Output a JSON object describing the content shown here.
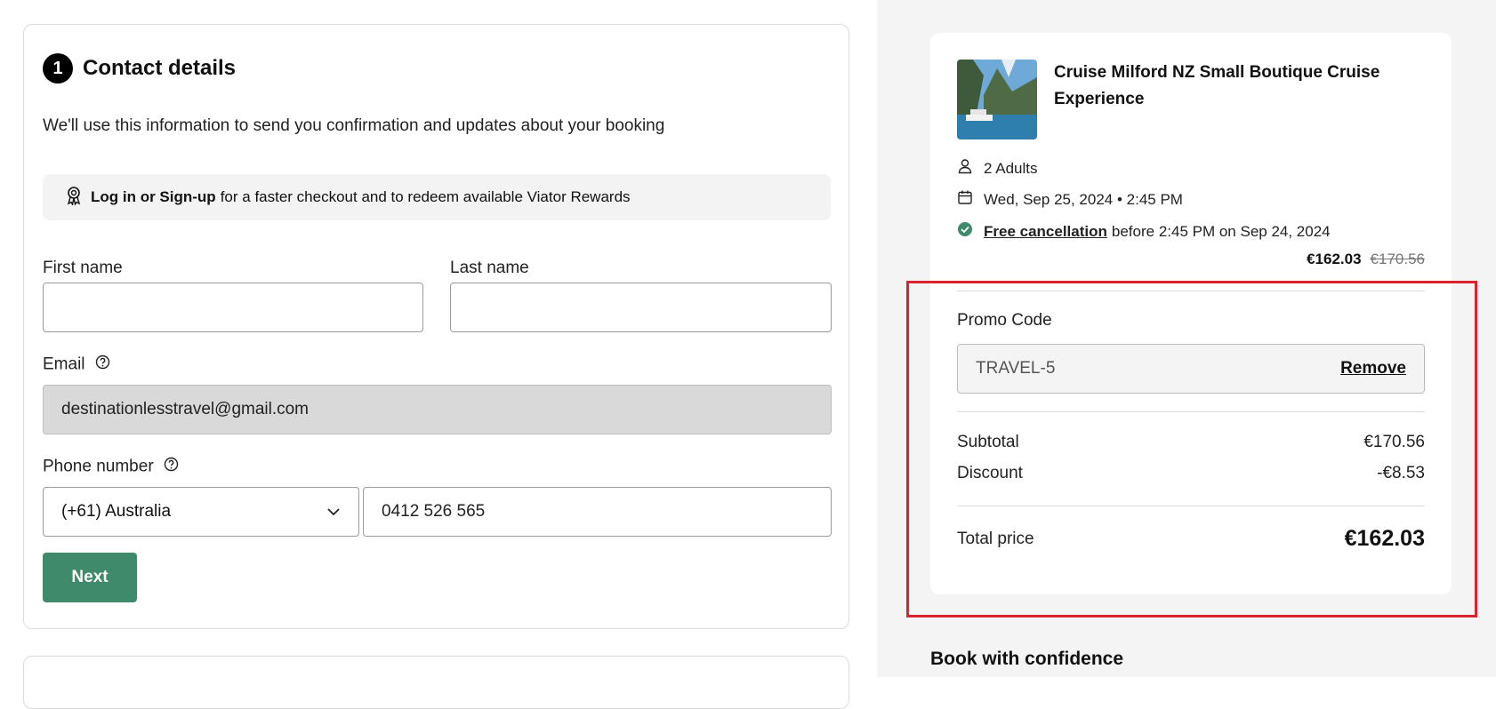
{
  "contact": {
    "step_number": "1",
    "title": "Contact details",
    "description": "We'll use this information to send you confirmation and updates about your booking",
    "login_banner": {
      "strong_text": "Log in or Sign-up",
      "text": "for a faster checkout and to redeem available Viator Rewards"
    },
    "first_name": {
      "label": "First name",
      "value": ""
    },
    "last_name": {
      "label": "Last name",
      "value": ""
    },
    "email": {
      "label": "Email",
      "value": "destinationlesstravel@gmail.com"
    },
    "phone": {
      "label": "Phone number",
      "country": "(+61) Australia",
      "number": "0412 526 565"
    },
    "next_label": "Next"
  },
  "summary": {
    "tour_title": "Cruise Milford NZ Small Boutique Cruise Experience",
    "travelers": "2 Adults",
    "date_time": "Wed, Sep 25, 2024 • 2:45 PM",
    "free_cancellation": "Free cancellation",
    "cancellation_detail": "before 2:45 PM on Sep 24, 2024",
    "price_now": "€162.03",
    "price_was": "€170.56",
    "promo_label": "Promo Code",
    "promo_code": "TRAVEL-5",
    "remove_label": "Remove",
    "subtotal_label": "Subtotal",
    "subtotal_value": "€170.56",
    "discount_label": "Discount",
    "discount_value": "-€8.53",
    "total_label": "Total price",
    "total_value": "€162.03"
  },
  "confidence_heading": "Book with confidence",
  "colors": {
    "accent_green": "#3f8a6a",
    "highlight_red": "#d9232e",
    "panel_gray": "#f4f4f4"
  }
}
